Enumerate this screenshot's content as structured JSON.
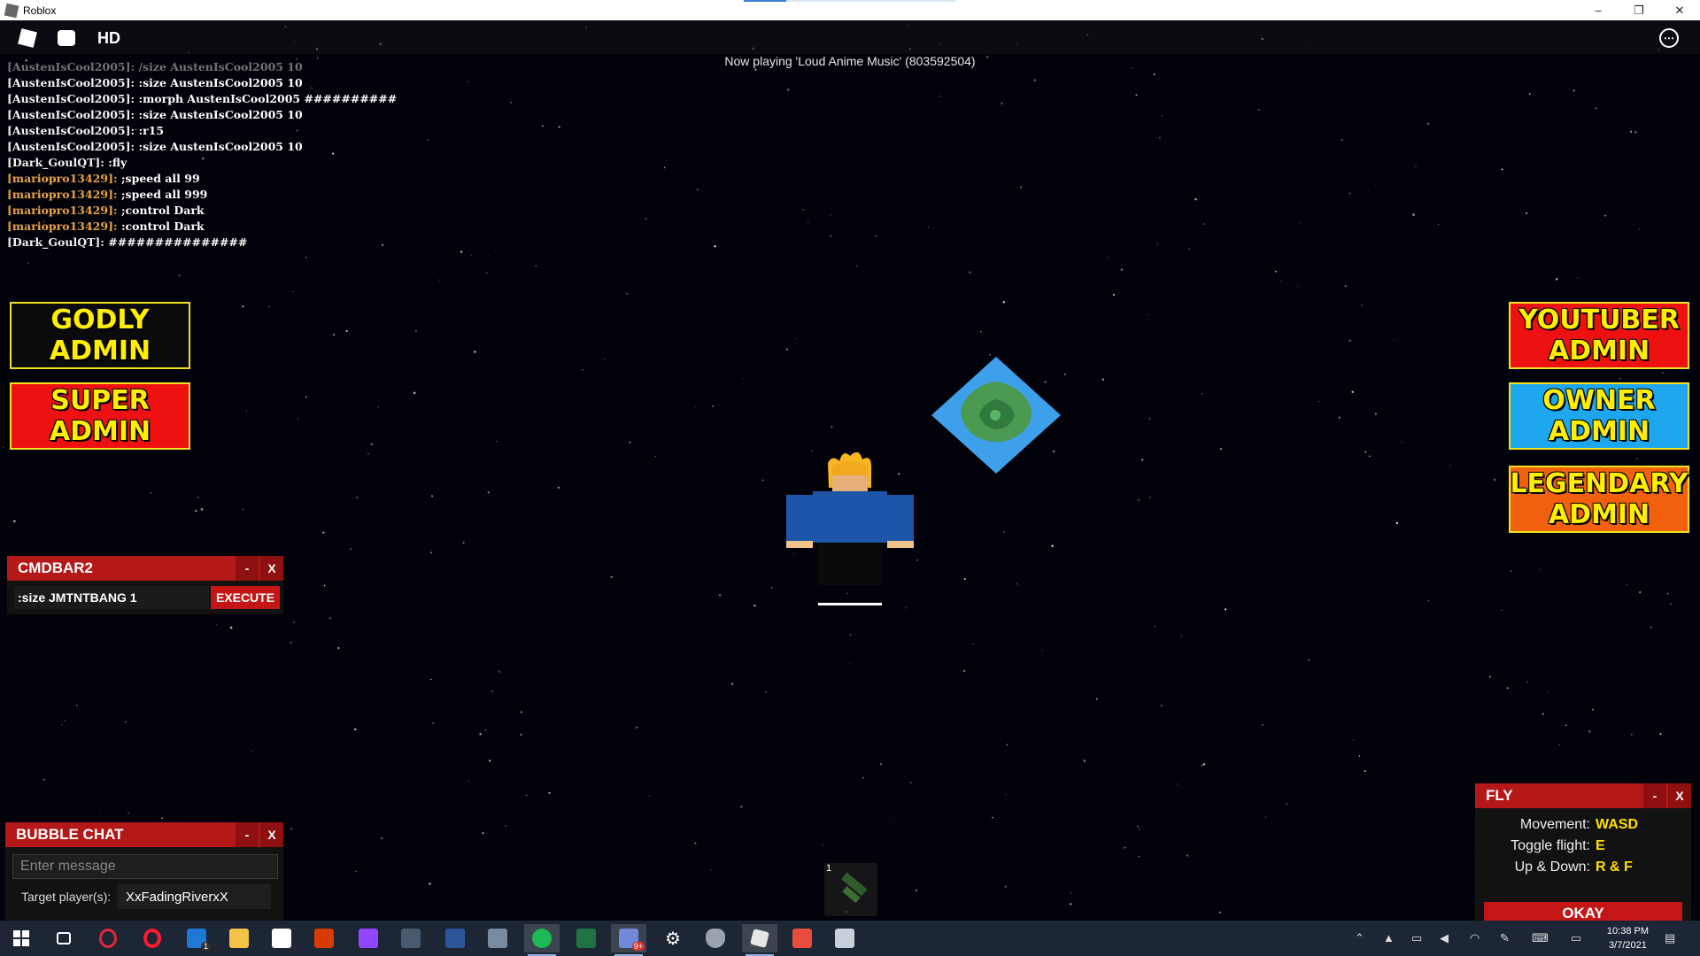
{
  "window": {
    "title": "Roblox",
    "minimize_glyph": "–",
    "maximize_glyph": "❐",
    "close_glyph": "✕"
  },
  "topbar": {
    "icons": [
      "roblox-menu-icon",
      "chat-icon",
      "hd-icon",
      "more-options-icon"
    ],
    "hd_label": "HD",
    "more_glyph": "⋯"
  },
  "now_playing": "Now playing 'Loud Anime Music' (803592504)",
  "chat": {
    "name_colors": {
      "AustenIsCool2005": "#f2f2f2",
      "Dark_GoulQT": "#f2f2f2",
      "mariopro13429": "#e8a34a"
    },
    "lines": [
      {
        "name": "[AustenIsCool2005]:",
        "msg": " /size AustenIsCool2005 10",
        "color": "#cfcfcf",
        "faded": true
      },
      {
        "name": "[AustenIsCool2005]:",
        "msg": " :size AustenIsCool2005 10",
        "color": "#f2f2f2",
        "faded": false
      },
      {
        "name": "[AustenIsCool2005]:",
        "msg": " :morph AustenIsCool2005 ##########",
        "color": "#f2f2f2",
        "faded": false
      },
      {
        "name": "[AustenIsCool2005]:",
        "msg": " :size AustenIsCool2005 10",
        "color": "#f2f2f2",
        "faded": false
      },
      {
        "name": "[AustenIsCool2005]:",
        "msg": " :r15",
        "color": "#f2f2f2",
        "faded": false
      },
      {
        "name": "[AustenIsCool2005]:",
        "msg": " :size AustenIsCool2005 10",
        "color": "#f2f2f2",
        "faded": false
      },
      {
        "name": "[Dark_GoulQT]:",
        "msg": " :fly",
        "color": "#f2f2f2",
        "faded": false
      },
      {
        "name": "[mariopro13429]:",
        "msg": " ;speed all 99",
        "color": "#e8a34a",
        "faded": false
      },
      {
        "name": "[mariopro13429]:",
        "msg": " ;speed all 999",
        "color": "#e8a34a",
        "faded": false
      },
      {
        "name": "[mariopro13429]:",
        "msg": " ;control Dark",
        "color": "#e8a34a",
        "faded": false
      },
      {
        "name": "[mariopro13429]:",
        "msg": " :control Dark",
        "color": "#e8a34a",
        "faded": false
      },
      {
        "name": "[Dark_GoulQT]:",
        "msg": " ###############",
        "color": "#f2f2f2",
        "faded": false
      }
    ]
  },
  "ranks": {
    "godly": {
      "line1": "GODLY",
      "line2": "ADMIN",
      "bg": "#0b0b0b"
    },
    "super": {
      "line1": "SUPER",
      "line2": "ADMIN",
      "bg": "#ee1111"
    },
    "youtuber": {
      "line1": "YOUTUBER",
      "line2": "ADMIN",
      "bg": "#ee1111"
    },
    "owner": {
      "line1": "OWNER",
      "line2": "ADMIN",
      "bg": "#1ea7ee"
    },
    "legendary": {
      "line1": "LEGENDARY",
      "line2": "ADMIN",
      "bg": "#f0600d"
    }
  },
  "cmdbar": {
    "title": "CMDBAR2",
    "minimize": "-",
    "close": "X",
    "input_value": ":size JMTNTBANG 1",
    "execute_label": "EXECUTE"
  },
  "bubble_chat": {
    "title": "BUBBLE CHAT",
    "minimize": "-",
    "close": "X",
    "placeholder": "Enter message",
    "target_label": "Target player(s):",
    "target_value": "XxFadingRiverxX"
  },
  "fly": {
    "title": "FLY",
    "minimize": "-",
    "close": "X",
    "rows": [
      {
        "label": "Movement:",
        "value": "WASD"
      },
      {
        "label": "Toggle flight:",
        "value": "E"
      },
      {
        "label": "Up & Down:",
        "value": "R & F"
      }
    ],
    "okay_label": "OKAY"
  },
  "hotbar": {
    "slot_number": "1",
    "tool_icon": "gun-tool-icon"
  },
  "taskbar": {
    "apps": [
      "start",
      "task-view",
      "opera-gx",
      "opera",
      "mail",
      "file-explorer",
      "store",
      "office",
      "twitch",
      "calculator",
      "word",
      "snipping-tool",
      "spotify",
      "excel",
      "discord",
      "settings",
      "security",
      "roblox",
      "roblox-studio",
      "roblox-player"
    ],
    "mail_badge": "1",
    "discord_badge": "9+",
    "time": "10:38 PM",
    "date": "3/7/2021"
  }
}
